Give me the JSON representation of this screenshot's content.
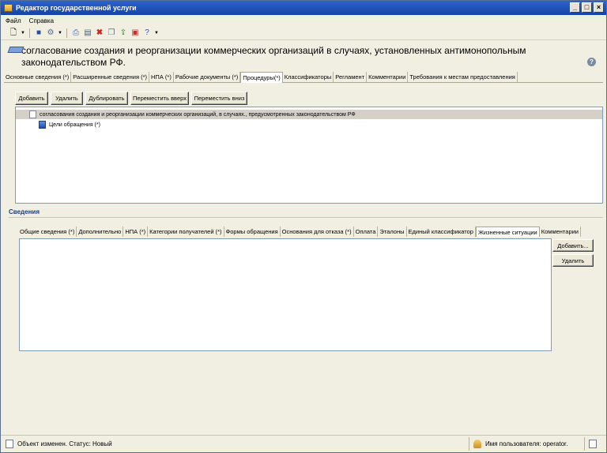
{
  "window": {
    "title": "Редактор государственной услуги",
    "controls": {
      "minimize": "_",
      "maximize": "□",
      "close": "×"
    }
  },
  "menu": [
    "Файл",
    "Справка"
  ],
  "toolbar_icons": [
    "new-document-icon",
    "dropdown-arrow-icon",
    "save-icon",
    "settings-icon",
    "dropdown-arrow-icon",
    "print-icon",
    "page-icon",
    "delete-icon",
    "copy-icon",
    "export-icon",
    "import-icon",
    "help-icon",
    "dropdown-arrow-icon"
  ],
  "header": {
    "title": "согласование создания и реорганизации коммерческих организаций в случаях, установленных антимонопольным законодательством РФ.",
    "help_label": "?"
  },
  "tabs_top": [
    "Основные сведения (*)",
    "Расширенные сведения (*)",
    "НПА (*)",
    "Рабочие документы (*)",
    "Процедуры(*)",
    "Классификаторы",
    "Регламент",
    "Комментарии",
    "Требования к местам предоставления"
  ],
  "active_top_tab": "Процедуры(*)",
  "procedure_buttons": {
    "add": "Добавить",
    "delete": "Удалить",
    "duplicate": "Дублировать",
    "move_up": "Переместить вверх",
    "move_down": "Переместить вниз"
  },
  "tree": [
    {
      "label": "согласования создания и реорганизации коммерческих организаций, в случаях., предусмотренных законодательством РФ",
      "icon": "page-icon",
      "selected": true
    },
    {
      "label": "Цели обращения (*)",
      "icon": "book-icon",
      "selected": false
    }
  ],
  "section": {
    "title": "Сведения"
  },
  "tabs_bottom": [
    "Общие сведения (*)",
    "Дополнительно",
    "НПА (*)",
    "Категории получателей (*)",
    "Формы обращения",
    "Основания для отказа (*)",
    "Оплата",
    "Эталоны",
    "Единый классификатор",
    "Жизненные ситуации",
    "Комментарии"
  ],
  "active_bottom_tab": "Жизненные ситуации",
  "side_buttons": {
    "add": "Добавить...",
    "delete": "Удалить"
  },
  "status": {
    "left": "Объект изменен. Статус: Новый",
    "right": "Имя пользователя: operator."
  },
  "colors": {
    "titlebar": "#1f54bf",
    "window_bg": "#f1efe2",
    "section_title": "#1b3d82",
    "border_blue": "#7f9db9"
  }
}
